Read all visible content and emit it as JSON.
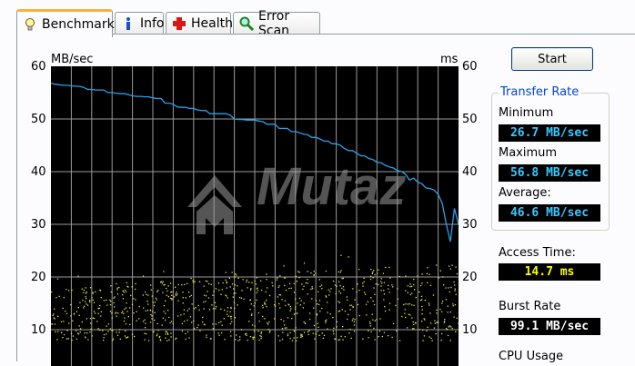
{
  "tabs": [
    {
      "label": "Benchmark",
      "icon": "lightbulb-icon"
    },
    {
      "label": "Info",
      "icon": "info-icon"
    },
    {
      "label": "Health",
      "icon": "health-cross-icon"
    },
    {
      "label": "Error Scan",
      "icon": "magnifier-icon"
    }
  ],
  "chart": {
    "left_unit": "MB/sec",
    "right_unit": "ms",
    "y_ticks": [
      "60",
      "50",
      "40",
      "30",
      "20",
      "10"
    ],
    "watermark": "Mutaz"
  },
  "controls": {
    "start_label": "Start"
  },
  "transfer_rate": {
    "title": "Transfer Rate",
    "minimum_label": "Minimum",
    "minimum_value": "26.7 MB/sec",
    "maximum_label": "Maximum",
    "maximum_value": "56.8 MB/sec",
    "average_label": "Average:",
    "average_value": "46.6 MB/sec"
  },
  "access_time": {
    "label": "Access Time:",
    "value": "14.7 ms"
  },
  "burst_rate": {
    "label": "Burst Rate",
    "value": "99.1 MB/sec"
  },
  "cpu_usage": {
    "label": "CPU Usage"
  },
  "colors": {
    "transfer_line": "#2aa0e8",
    "access_points": "#e6e64a",
    "grid": "#9a9a9a",
    "tab_highlight": "#f8b23b",
    "group_title": "#0046d5"
  },
  "chart_data": {
    "type": "line",
    "ylim": [
      0,
      60
    ],
    "y2lim": [
      0,
      60
    ],
    "series": [
      {
        "name": "Transfer Rate",
        "axis": "MB/sec",
        "x": [
          0,
          1,
          2,
          3,
          4,
          5,
          6,
          7,
          8,
          9,
          10,
          11,
          12,
          13,
          14,
          15,
          16,
          17,
          18,
          19,
          20,
          21,
          22,
          23,
          24,
          25,
          26,
          27,
          28,
          29,
          30,
          31,
          32,
          33,
          34,
          35,
          36,
          37,
          38,
          39,
          40,
          41,
          42,
          43,
          44,
          45,
          46,
          47,
          48,
          49,
          50,
          51,
          52,
          53,
          54,
          55,
          56,
          57,
          58,
          59,
          60,
          61,
          62,
          63,
          64,
          65,
          66,
          67,
          68,
          69,
          70,
          71,
          72,
          73,
          74,
          75,
          76,
          77,
          78,
          79,
          80,
          81,
          82,
          83,
          84,
          85,
          86,
          87,
          88,
          89,
          90,
          91,
          92,
          93,
          94,
          95,
          96,
          97,
          98,
          99,
          100
        ],
        "y": [
          56.8,
          56.6,
          56.5,
          56.4,
          56.4,
          56.3,
          56.2,
          56.2,
          56.0,
          55.6,
          55.6,
          55.5,
          55.5,
          55.5,
          55.0,
          55.0,
          54.9,
          54.8,
          54.8,
          54.6,
          54.4,
          54.3,
          54.3,
          54.2,
          54.2,
          54.0,
          53.9,
          53.9,
          53.0,
          53.0,
          52.8,
          52.3,
          52.2,
          52.2,
          52.0,
          52.0,
          51.7,
          51.6,
          51.6,
          51.0,
          51.0,
          51.0,
          51.0,
          51.0,
          50.7,
          50.0,
          49.9,
          49.9,
          49.8,
          49.8,
          49.8,
          49.6,
          49.5,
          49.0,
          49.0,
          49.0,
          48.2,
          48.2,
          48.2,
          47.6,
          47.6,
          47.4,
          47.1,
          47.0,
          46.5,
          46.5,
          46.2,
          45.8,
          45.8,
          45.3,
          45.3,
          45.0,
          44.4,
          44.0,
          44.0,
          43.5,
          43.0,
          43.0,
          42.5,
          42.3,
          41.8,
          41.7,
          41.2,
          40.9,
          40.7,
          40.2,
          40.0,
          39.5,
          38.4,
          38.8,
          38.0,
          37.7,
          36.9,
          36.8,
          36.5,
          35.7,
          34.0,
          30.0,
          26.7,
          33.0,
          30.0
        ]
      },
      {
        "name": "Access Time",
        "axis": "ms",
        "approx_band": "8-25 ms scatter, average 14.7 ms"
      }
    ]
  }
}
